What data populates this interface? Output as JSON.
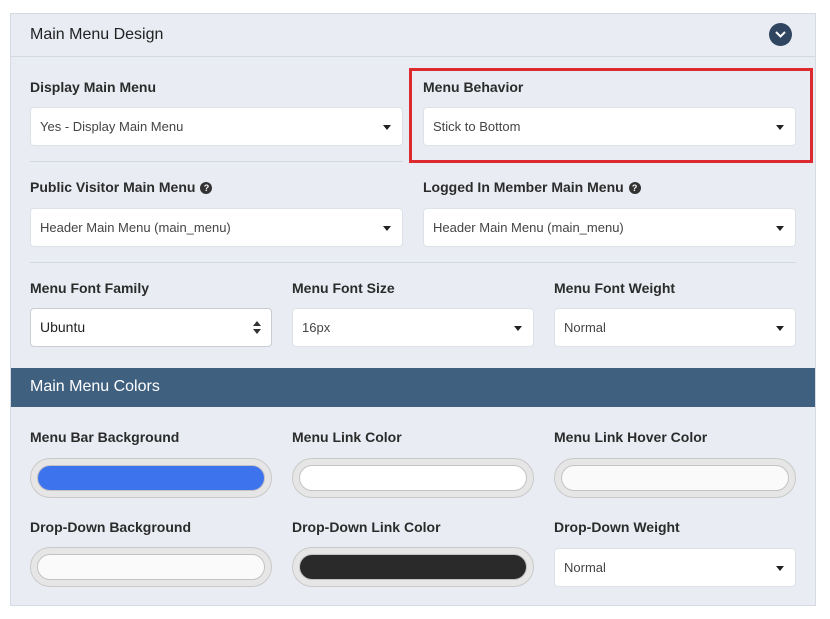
{
  "section": {
    "title": "Main Menu Design",
    "collapse_icon": "chevron-down-icon"
  },
  "display_menu": {
    "label": "Display Main Menu",
    "value": "Yes - Display Main Menu"
  },
  "menu_behavior": {
    "label": "Menu Behavior",
    "value": "Stick to Bottom"
  },
  "public_menu": {
    "label": "Public Visitor Main Menu",
    "value": "Header Main Menu (main_menu)"
  },
  "member_menu": {
    "label": "Logged In Member Main Menu",
    "value": "Header Main Menu (main_menu)"
  },
  "font_family": {
    "label": "Menu Font Family",
    "value": "Ubuntu"
  },
  "font_size": {
    "label": "Menu Font Size",
    "value": "16px"
  },
  "font_weight": {
    "label": "Menu Font Weight",
    "value": "Normal"
  },
  "colors_section": {
    "title": "Main Menu Colors"
  },
  "bar_bg": {
    "label": "Menu Bar Background",
    "color": "#3d74ee"
  },
  "link_color": {
    "label": "Menu Link Color",
    "color": "#ffffff"
  },
  "link_hover": {
    "label": "Menu Link Hover Color",
    "color": "#fafafa"
  },
  "dropdown_bg": {
    "label": "Drop-Down Background",
    "color": "#fafafa"
  },
  "dropdown_link": {
    "label": "Drop-Down Link Color",
    "color": "#2a2a2a"
  },
  "dropdown_weight": {
    "label": "Drop-Down Weight",
    "value": "Normal"
  },
  "theme": {
    "accent": "#40607f",
    "highlight": "#dd2a2f",
    "panel_bg": "#e9edf3"
  }
}
